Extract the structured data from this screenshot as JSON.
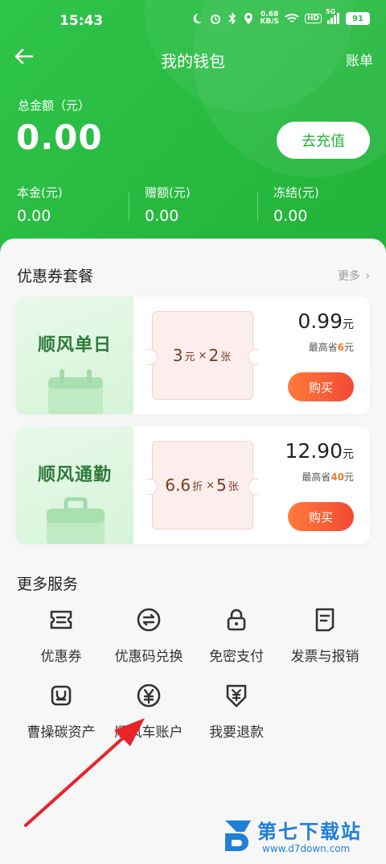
{
  "status_bar": {
    "time": "15:43",
    "net_speed_value": "0.68",
    "net_speed_unit": "KB/S",
    "hd_label": "HD",
    "signal_label": "5G",
    "battery": "91"
  },
  "nav": {
    "title": "我的钱包",
    "bill": "账单"
  },
  "wallet": {
    "total_label": "总金额（元）",
    "total_value": "0.00",
    "recharge_label": "去充值",
    "principal_label": "本金(元)",
    "principal_value": "0.00",
    "bonus_label": "赠额(元)",
    "bonus_value": "0.00",
    "frozen_label": "冻结(元)",
    "frozen_value": "0.00"
  },
  "coupons": {
    "section_title": "优惠券套餐",
    "more": "更多",
    "packages": [
      {
        "name": "顺风单日",
        "ticket_amount": "3",
        "ticket_unit": "元",
        "times": "×",
        "ticket_count": "2",
        "count_unit": "张",
        "price": "0.99",
        "price_unit": "元",
        "save_prefix": "最高省",
        "save_amount": "6",
        "save_unit": "元",
        "buy": "购买"
      },
      {
        "name": "顺风通勤",
        "ticket_amount": "6.6",
        "ticket_unit": "折",
        "times": "×",
        "ticket_count": "5",
        "count_unit": "张",
        "price": "12.90",
        "price_unit": "元",
        "save_prefix": "最高省",
        "save_amount": "40",
        "save_unit": "元",
        "buy": "购买"
      }
    ]
  },
  "services": {
    "section_title": "更多服务",
    "items": [
      {
        "label": "优惠券",
        "icon": "coupon-icon"
      },
      {
        "label": "优惠码兑换",
        "icon": "exchange-icon"
      },
      {
        "label": "免密支付",
        "icon": "lock-icon"
      },
      {
        "label": "发票与报销",
        "icon": "invoice-icon"
      },
      {
        "label": "曹操碳资产",
        "icon": "carbon-icon"
      },
      {
        "label": "顺风车账户",
        "icon": "yuan-icon"
      },
      {
        "label": "我要退款",
        "icon": "refund-icon"
      }
    ]
  },
  "watermark": {
    "title": "第七下载站",
    "url": "www.d7down.com"
  },
  "colors": {
    "brand_green": "#2bbd44",
    "buy_orange": "#f24a34",
    "annotation_red": "#e8232a"
  }
}
